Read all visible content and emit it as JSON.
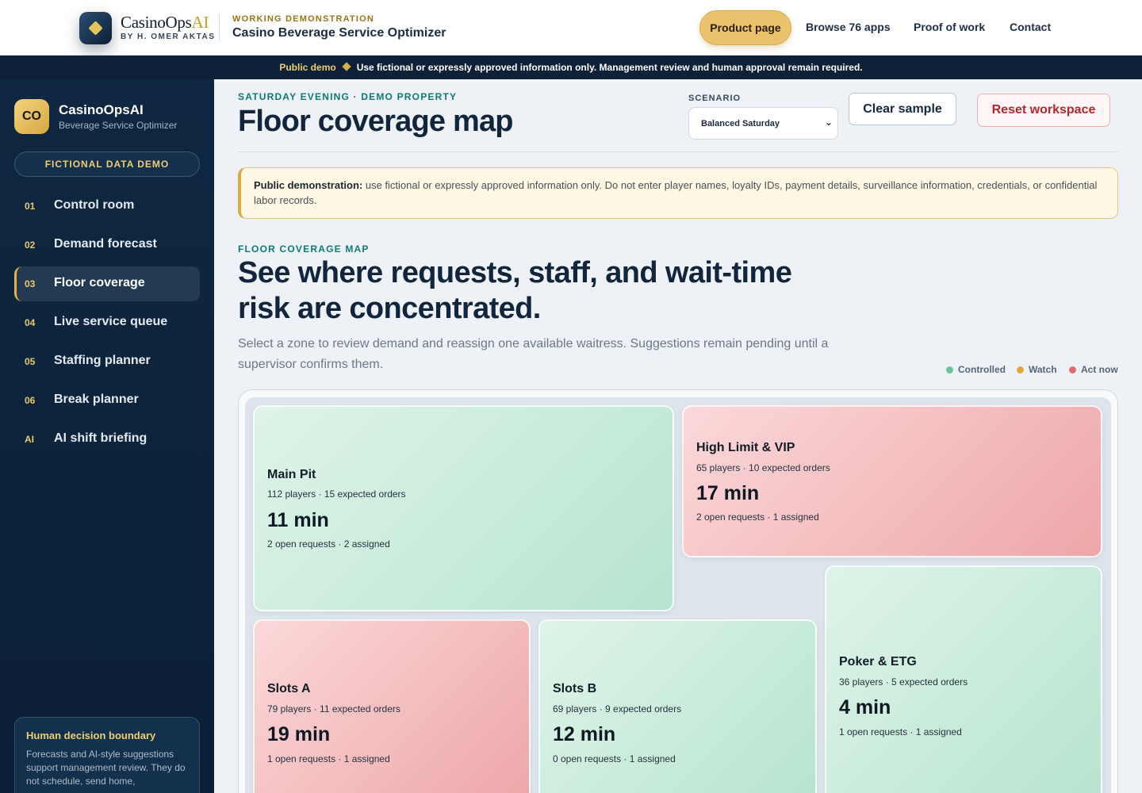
{
  "header": {
    "brand_name": "CasinoOps",
    "brand_name_accent": "AI",
    "brand_by": "BY H. OMER AKTAS",
    "app_kicker": "WORKING DEMONSTRATION",
    "app_title": "Casino Beverage Service Optimizer",
    "nav": [
      "Product page",
      "Browse 76 apps",
      "Proof of work",
      "Contact"
    ]
  },
  "strip": {
    "tag": "Public demo",
    "text": "Use fictional or expressly approved information only. Management review and human approval remain required."
  },
  "sidebar": {
    "avatar": "CO",
    "name": "CasinoOpsAI",
    "subtitle": "Beverage Service Optimizer",
    "badge": "FICTIONAL DATA DEMO",
    "items": [
      {
        "num": "01",
        "label": "Control room"
      },
      {
        "num": "02",
        "label": "Demand forecast"
      },
      {
        "num": "03",
        "label": "Floor coverage"
      },
      {
        "num": "04",
        "label": "Live service queue"
      },
      {
        "num": "05",
        "label": "Staffing planner"
      },
      {
        "num": "06",
        "label": "Break planner"
      },
      {
        "num": "AI",
        "label": "AI shift briefing"
      }
    ],
    "active_index": 2,
    "boundary_title": "Human decision boundary",
    "boundary_text": "Forecasts and AI-style suggestions support management review. They do not schedule, send home,"
  },
  "page": {
    "kicker": "SATURDAY EVENING · DEMO PROPERTY",
    "title": "Floor coverage map",
    "scenario_label": "SCENARIO",
    "scenario_value": "Balanced Saturday",
    "clear_label": "Clear sample",
    "reset_label": "Reset workspace",
    "notice_bold": "Public demonstration:",
    "notice_text": " use fictional or expressly approved information only. Do not enter player names, loyalty IDs, payment details, surveillance information, credentials, or confidential labor records.",
    "section_kicker": "FLOOR COVERAGE MAP",
    "headline": "See where requests, staff, and wait-time risk are concentrated.",
    "lede": "Select a zone to review demand and reassign one available waitress. Suggestions remain pending until a supervisor confirms them."
  },
  "legend": [
    {
      "label": "Controlled",
      "color": "#6cc3a0"
    },
    {
      "label": "Watch",
      "color": "#e0a93e"
    },
    {
      "label": "Act now",
      "color": "#e06a6c"
    }
  ],
  "zones": [
    {
      "name": "Main Pit",
      "players": 112,
      "orders": 15,
      "meta": "112 players · 15 expected orders",
      "wait": "11 min",
      "requests": "2 open requests · 2 assigned",
      "status": "controlled"
    },
    {
      "name": "High Limit & VIP",
      "players": 65,
      "orders": 10,
      "meta": "65 players · 10 expected orders",
      "wait": "17 min",
      "requests": "2 open requests · 1 assigned",
      "status": "act"
    },
    {
      "name": "Slots A",
      "players": 79,
      "orders": 11,
      "meta": "79 players · 11 expected orders",
      "wait": "19 min",
      "requests": "1 open requests · 1 assigned",
      "status": "act"
    },
    {
      "name": "Slots B",
      "players": 69,
      "orders": 9,
      "meta": "69 players · 9 expected orders",
      "wait": "12 min",
      "requests": "0 open requests · 1 assigned",
      "status": "controlled"
    },
    {
      "name": "Poker & ETG",
      "players": 36,
      "orders": 5,
      "meta": "36 players · 5 expected orders",
      "wait": "4 min",
      "requests": "1 open requests · 1 assigned",
      "status": "controlled"
    }
  ]
}
